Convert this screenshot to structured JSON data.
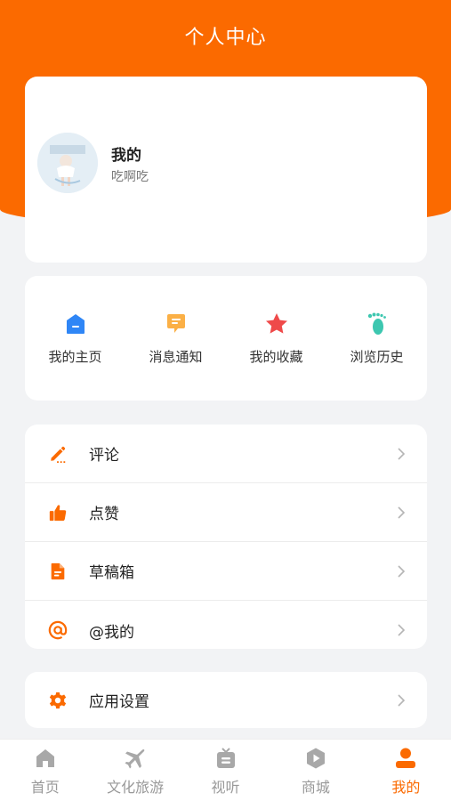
{
  "header": {
    "title": "个人中心"
  },
  "profile": {
    "name": "我的",
    "subtitle": "吃啊吃"
  },
  "quick_links": [
    {
      "label": "我的主页",
      "icon": "home-page-icon"
    },
    {
      "label": "消息通知",
      "icon": "message-icon"
    },
    {
      "label": "我的收藏",
      "icon": "star-icon"
    },
    {
      "label": "浏览历史",
      "icon": "footprint-icon"
    }
  ],
  "menu": [
    {
      "label": "评论",
      "icon": "pencil-icon"
    },
    {
      "label": "点赞",
      "icon": "thumbs-up-icon"
    },
    {
      "label": "草稿箱",
      "icon": "document-icon"
    },
    {
      "label": "@我的",
      "icon": "at-icon"
    }
  ],
  "settings": {
    "label": "应用设置",
    "icon": "gear-icon"
  },
  "tabs": [
    {
      "label": "首页",
      "icon": "home-icon"
    },
    {
      "label": "文化旅游",
      "icon": "plane-icon"
    },
    {
      "label": "视听",
      "icon": "tv-icon"
    },
    {
      "label": "商城",
      "icon": "shop-icon"
    },
    {
      "label": "我的",
      "icon": "user-icon"
    }
  ],
  "colors": {
    "accent": "#fb6a00",
    "blue": "#2f86f6",
    "red": "#ef4a4a",
    "teal": "#3dc7b0"
  }
}
